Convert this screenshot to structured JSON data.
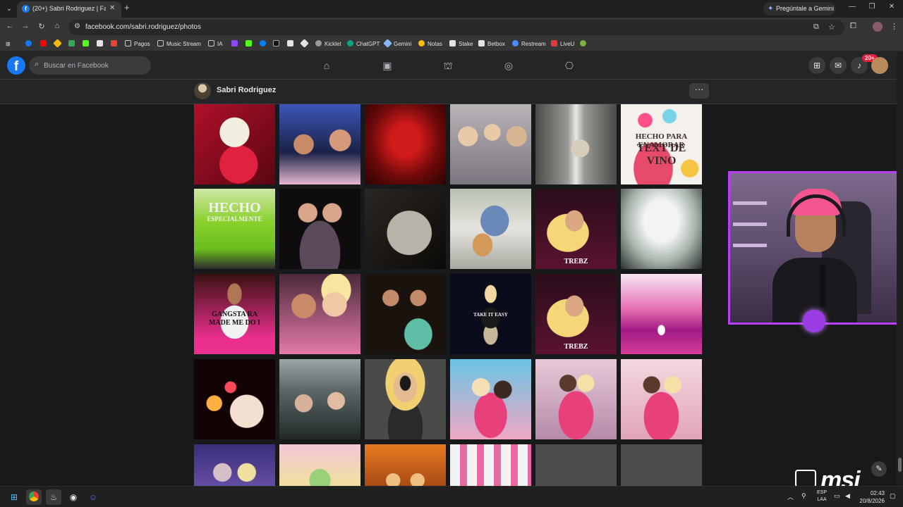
{
  "browser": {
    "tab_title": "(20+) Sabri Rodriguez | Faceboo",
    "gemini_button": "Pregúntale a Gemini",
    "url": "facebook.com/sabri.rodriguez/photos",
    "bookmarks": [
      "Pagos",
      "Music Stream",
      "IA",
      "Kicklet",
      "ChatGPT",
      "Gemini",
      "Notas",
      "Stake",
      "Betbox",
      "Restream",
      "LiveU"
    ]
  },
  "facebook": {
    "search_placeholder": "Buscar en Facebook",
    "notification_badge": "20+",
    "profile_name": "Sabri Rodriguez",
    "more_button": "···"
  },
  "photos": {
    "captions": {
      "valentine": "HECHO PARA ENAMORAR",
      "valentine_line2": "TEXT DE VINO",
      "mcd": "HECHO",
      "mcd_sub": "ESPECIALMENTE",
      "gangsta": "GANGSTA RA",
      "gangsta_line2": "MADE ME DO I",
      "take": "TAKE IT EASY",
      "crest": "TREBZ"
    }
  },
  "taskbar": {
    "lang_top": "ESP",
    "lang_bottom": "LAA",
    "time": "02:43",
    "date": "20/8/2026"
  },
  "overlay": {
    "brand": "msi"
  }
}
